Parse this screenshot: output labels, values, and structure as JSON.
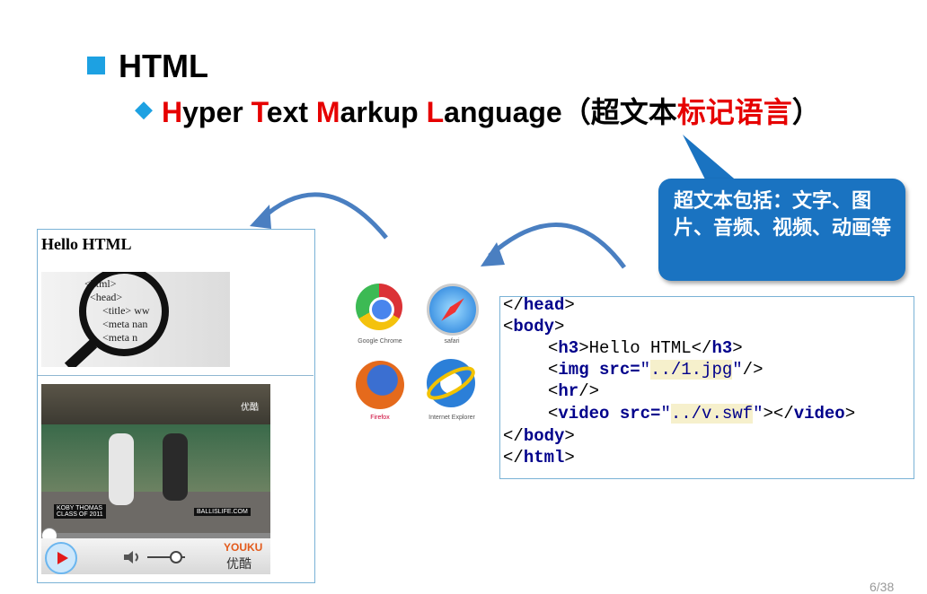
{
  "heading": {
    "title": "HTML",
    "subtitle_parts": [
      "H",
      "yper ",
      "T",
      "ext ",
      "M",
      "arkup ",
      "L",
      "anguage"
    ],
    "subtitle_paren_open": "（超文本",
    "subtitle_red_cn": "标记语言",
    "subtitle_paren_close": "）"
  },
  "callout": {
    "text": "超文本包括：文字、图片、音频、视频、动画等"
  },
  "render": {
    "h3": "Hello HTML",
    "code_image_lines": [
      "<html>",
      "<head>",
      "<title> ww",
      "<meta nan",
      "<meta n"
    ],
    "video_caption_left": "KOBY THOMAS",
    "video_caption_sub": "CLASS OF 2011",
    "video_watermark": "BALLISLIFE.COM",
    "video_corner": "优酷",
    "player_logo_top": "YOUKU",
    "player_logo_bottom": "优酷"
  },
  "browsers": [
    {
      "name": "Google Chrome",
      "icon": "chrome-icon"
    },
    {
      "name": "safari",
      "icon": "safari-icon"
    },
    {
      "name": "Firefox",
      "icon": "firefox-icon"
    },
    {
      "name": "Internet Explorer",
      "icon": "ie-icon"
    }
  ],
  "code": {
    "l1": {
      "open": "</",
      "tag": "head",
      "close": ">"
    },
    "l2": {
      "open": "<",
      "tag": "body",
      "close": ">"
    },
    "l3": {
      "open": "<",
      "tag": "h3",
      "mid": ">Hello HTML</",
      "tag2": "h3",
      "close": ">"
    },
    "l4": {
      "open": "<",
      "tag": "img",
      "attr": " src=",
      "q1": "\"",
      "val": "../1.jpg",
      "q2": "\"",
      "close": "/>"
    },
    "l5": {
      "open": "<",
      "tag": "hr",
      "close": "/>"
    },
    "l6": {
      "open": "<",
      "tag": "video",
      "attr": " src=",
      "q1": "\"",
      "val": "../v.swf",
      "q2": "\"",
      "mid": "></",
      "tag2": "video",
      "close": ">"
    },
    "l7": {
      "open": "</",
      "tag": "body",
      "close": ">"
    },
    "l8": {
      "open": "</",
      "tag": "html",
      "close": ">"
    }
  },
  "slide_number": "6/38",
  "colors": {
    "accent": "#1da1e2",
    "red": "#e60000",
    "callout": "#1a73c1",
    "code_keyword": "#00008b"
  }
}
